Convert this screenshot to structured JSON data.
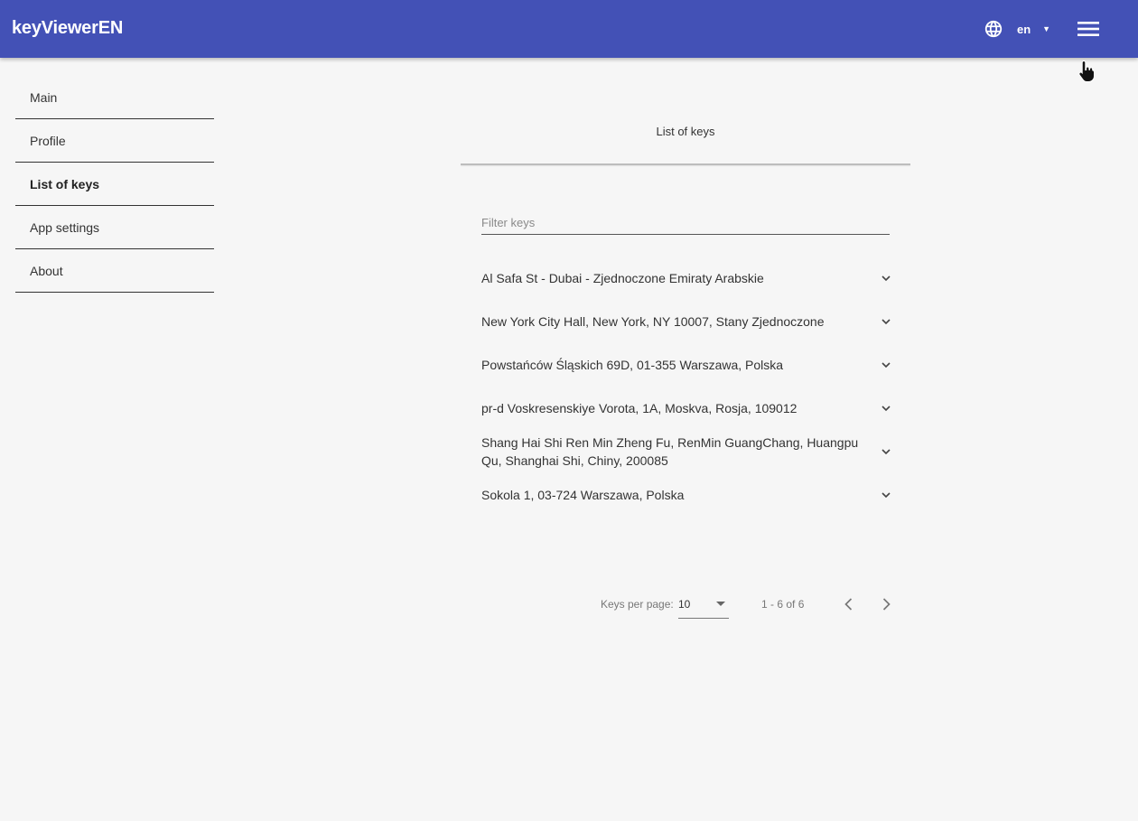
{
  "header": {
    "app_title": "keyViewerEN",
    "language": "en",
    "icons": {
      "language": "globe-icon",
      "menu": "hamburger-menu-icon",
      "language_caret": "caret-down-icon"
    },
    "background_color": "#4351b6"
  },
  "sidebar": {
    "items": [
      {
        "label": "Main",
        "active": false
      },
      {
        "label": "Profile",
        "active": false
      },
      {
        "label": "List of keys",
        "active": true
      },
      {
        "label": "App settings",
        "active": false
      },
      {
        "label": "About",
        "active": false
      }
    ]
  },
  "main": {
    "title": "List of keys",
    "filter": {
      "placeholder": "Filter keys",
      "value": ""
    },
    "keys": [
      {
        "label": "Al Safa St - Dubai - Zjednoczone Emiraty Arabskie"
      },
      {
        "label": "New York City Hall, New York, NY 10007, Stany Zjednoczone"
      },
      {
        "label": "Powstańców Śląskich 69D, 01-355 Warszawa, Polska"
      },
      {
        "label": "pr-d Voskresenskiye Vorota, 1A, Moskva, Rosja, 109012"
      },
      {
        "label": "Shang Hai Shi Ren Min Zheng Fu, RenMin GuangChang, Huangpu Qu, Shanghai Shi, Chiny, 200085"
      },
      {
        "label": "Sokola 1, 03-724 Warszawa, Polska"
      }
    ],
    "paginator": {
      "page_size_label": "Keys per page:",
      "page_size": "10",
      "range_label": "1 - 6 of 6",
      "icons": {
        "prev": "chevron-left-icon",
        "next": "chevron-right-icon"
      }
    }
  }
}
